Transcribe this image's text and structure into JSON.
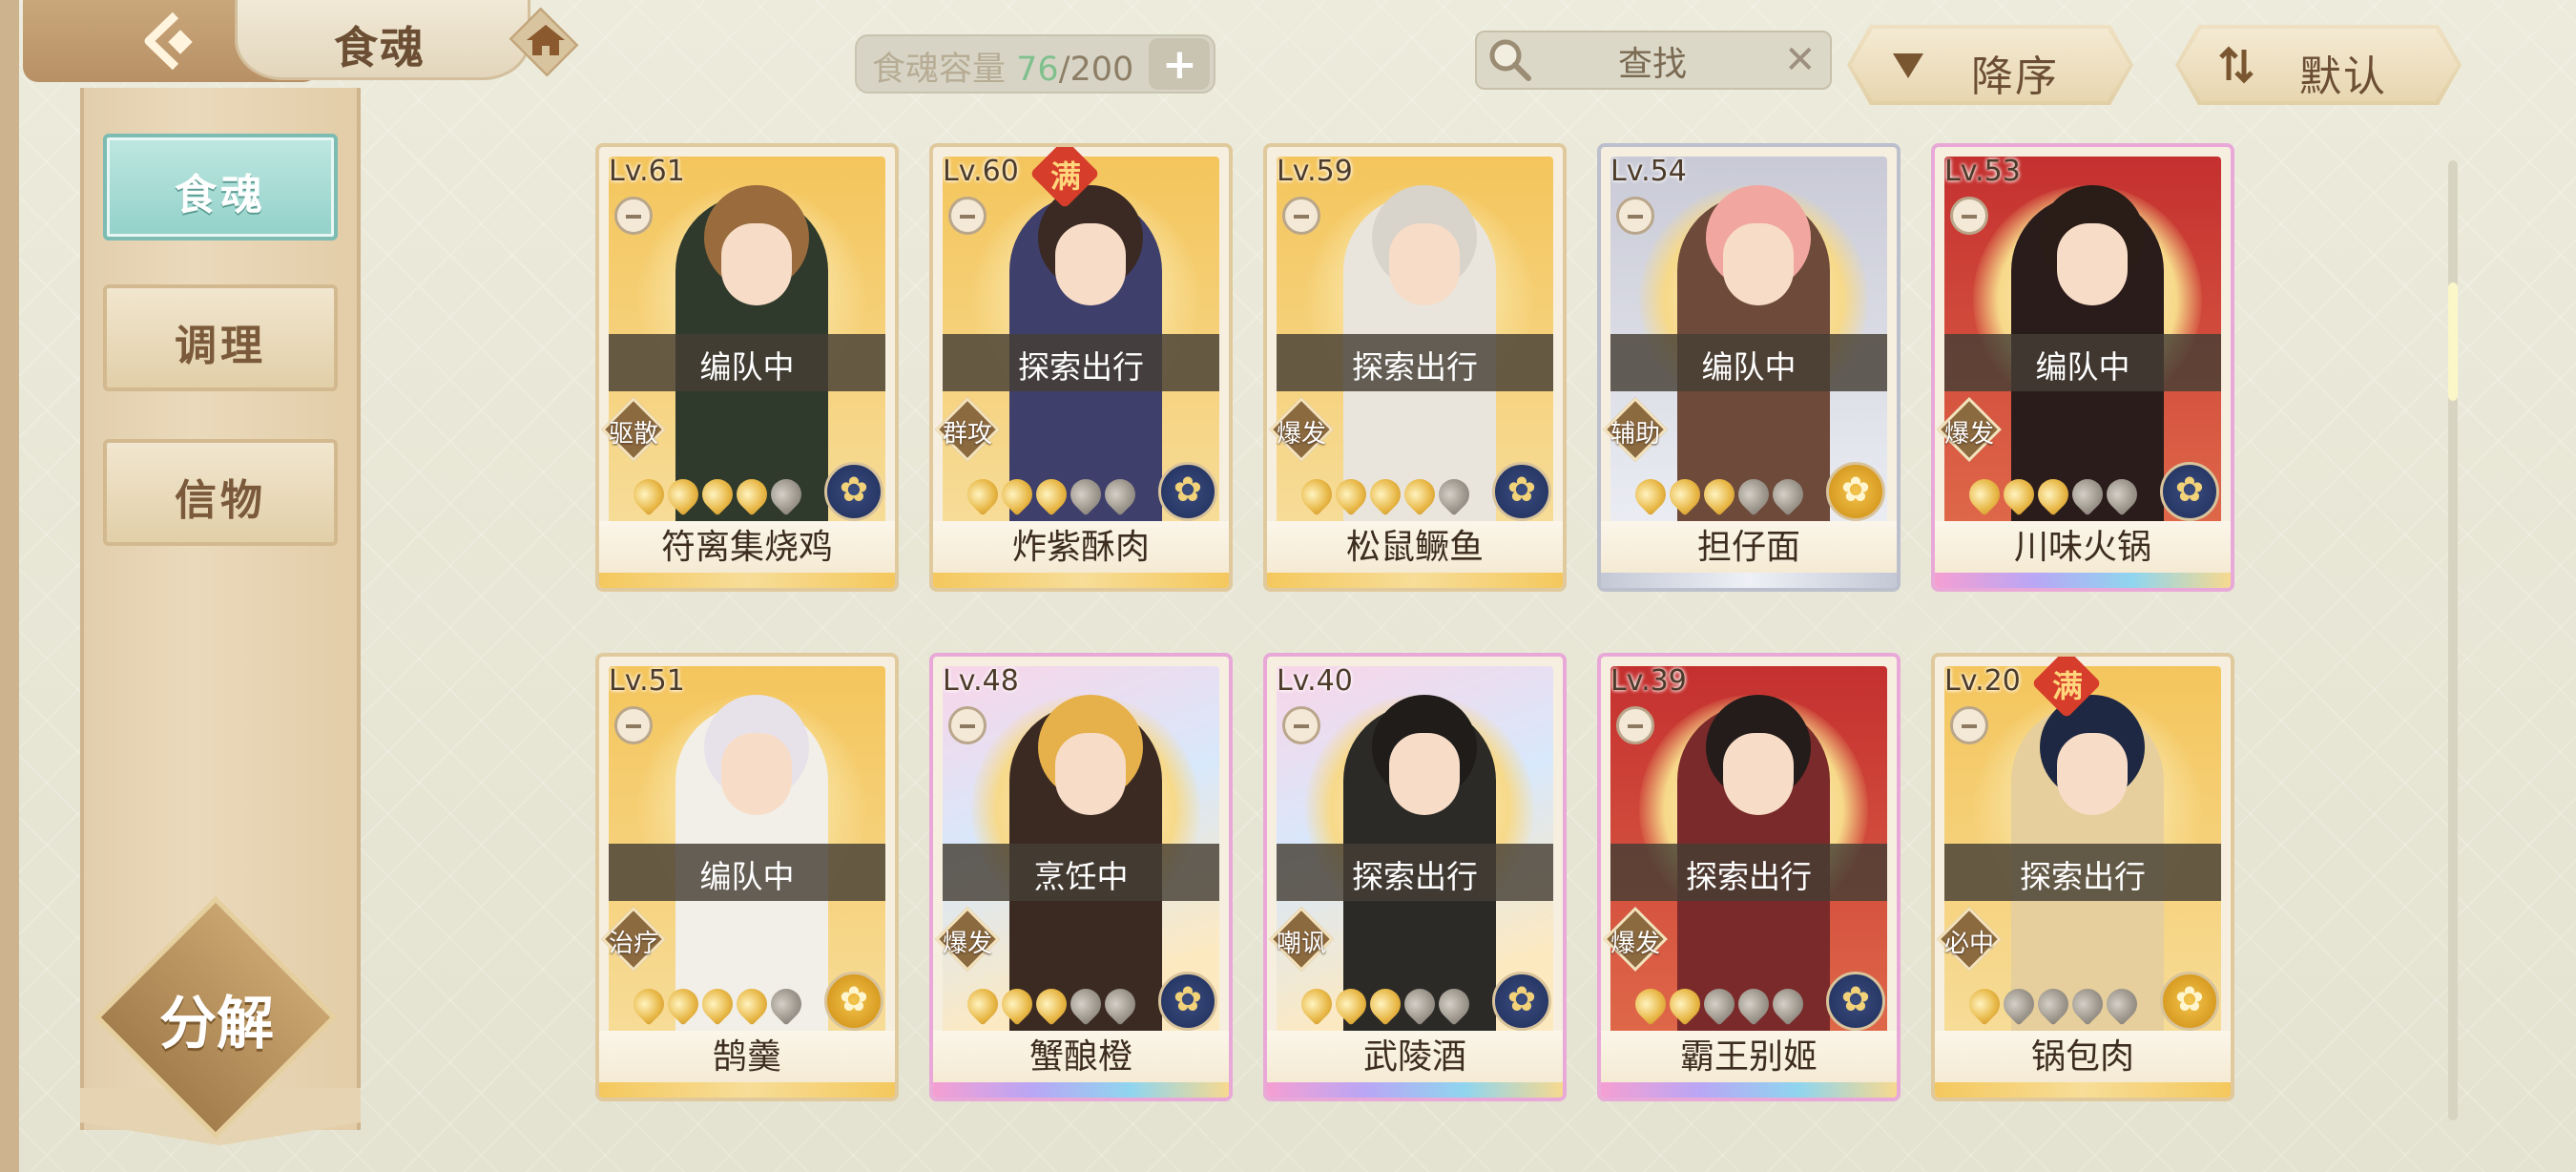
{
  "header": {
    "title": "食魂",
    "capacity_label": "食魂容量",
    "capacity_current": "76",
    "capacity_max": "200",
    "capacity_sep": "/",
    "search_placeholder": "查找",
    "sort_order_label": "降序",
    "sort_mode_label": "默认"
  },
  "sidebar": {
    "tabs": [
      {
        "label": "食魂",
        "active": true
      },
      {
        "label": "调理",
        "active": false
      },
      {
        "label": "信物",
        "active": false
      }
    ],
    "decompose_label": "分解"
  },
  "cards": [
    {
      "level": "Lv.61",
      "status": "编队中",
      "role": "驱散",
      "name": "符离集烧鸡",
      "stars_on": 4,
      "full": false,
      "element": "blue"
    },
    {
      "level": "Lv.60",
      "status": "探索出行",
      "role": "群攻",
      "name": "炸紫酥肉",
      "stars_on": 3,
      "full": true,
      "full_label": "满",
      "element": "blue"
    },
    {
      "level": "Lv.59",
      "status": "探索出行",
      "role": "爆发",
      "name": "松鼠鳜鱼",
      "stars_on": 4,
      "full": false,
      "element": "blue"
    },
    {
      "level": "Lv.54",
      "status": "编队中",
      "role": "辅助",
      "name": "担仔面",
      "stars_on": 3,
      "full": false,
      "element": "gold"
    },
    {
      "level": "Lv.53",
      "status": "编队中",
      "role": "爆发",
      "name": "川味火锅",
      "stars_on": 3,
      "full": false,
      "element": "blue"
    },
    {
      "level": "Lv.51",
      "status": "编队中",
      "role": "治疗",
      "name": "鹄羹",
      "stars_on": 4,
      "full": false,
      "element": "gold"
    },
    {
      "level": "Lv.48",
      "status": "烹饪中",
      "role": "爆发",
      "name": "蟹酿橙",
      "stars_on": 3,
      "full": false,
      "element": "blue"
    },
    {
      "level": "Lv.40",
      "status": "探索出行",
      "role": "嘲讽",
      "name": "武陵酒",
      "stars_on": 3,
      "full": false,
      "element": "blue"
    },
    {
      "level": "Lv.39",
      "status": "探索出行",
      "role": "爆发",
      "name": "霸王别姬",
      "stars_on": 2,
      "full": false,
      "element": "blue"
    },
    {
      "level": "Lv.20",
      "status": "探索出行",
      "role": "必中",
      "name": "锅包肉",
      "stars_on": 1,
      "full": true,
      "full_label": "满",
      "element": "gold"
    }
  ],
  "colors": {
    "capacity_current": "#7fc08d",
    "active_tab": "#92d1c9",
    "background": "#e9e7d7"
  }
}
